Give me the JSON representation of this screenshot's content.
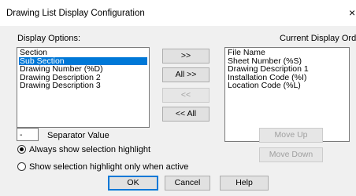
{
  "window": {
    "title": "Drawing List Display Configuration",
    "close_glyph": "×"
  },
  "display_options": {
    "label": "Display Options:",
    "items": [
      "Section",
      "Sub Section",
      "Drawing Number (%D)",
      "Drawing Description 2",
      "Drawing Description 3"
    ],
    "selected_index": 1
  },
  "current_order": {
    "label": "Current Display Order:",
    "items": [
      "File Name",
      "Sheet Number (%S)",
      "Drawing Description 1",
      "Installation Code (%I)",
      "Location Code (%L)"
    ]
  },
  "buttons": {
    "add": ">>",
    "add_all": "All >>",
    "remove": "<<",
    "remove_all": "<< All",
    "move_up": "Move Up",
    "move_down": "Move Down",
    "ok": "OK",
    "cancel": "Cancel",
    "help": "Help"
  },
  "separator": {
    "value": "-",
    "label": "Separator Value"
  },
  "highlight_options": {
    "always": "Always show selection highlight",
    "when_active": "Show selection highlight only when active",
    "selected": "always"
  }
}
